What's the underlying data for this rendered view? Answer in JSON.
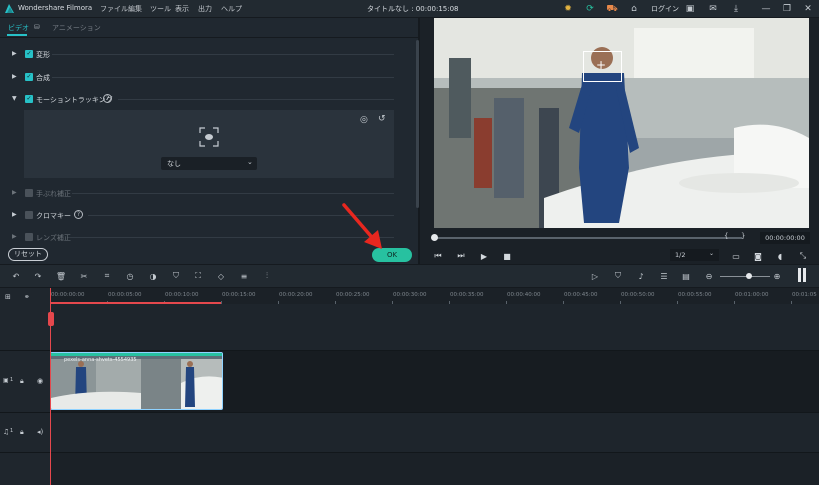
{
  "app": {
    "name": "Wondershare Filmora",
    "menus": [
      "ファイル",
      "編集",
      "ツール",
      "表示",
      "出力",
      "ヘルプ"
    ],
    "document_title": "タイトルなし : 00:00:15:08",
    "login_label": "ログイン",
    "accent_color": "#27c1c7",
    "ok_color": "#27c1a0",
    "playhead_color": "#e5484d"
  },
  "left_panel": {
    "tabs": [
      "ビデオ",
      "オーディオ",
      "アニメーション"
    ],
    "sections": [
      {
        "label": "変形",
        "checked": true
      },
      {
        "label": "合成",
        "checked": true
      },
      {
        "label": "モーショントラッキング",
        "checked": true
      },
      {
        "label": "手ぶれ補正",
        "checked": false
      },
      {
        "label": "クロマキー",
        "checked": false
      },
      {
        "label": "レンズ補正",
        "checked": false
      }
    ],
    "tracking_select": "なし",
    "reset_label": "リセット",
    "ok_label": "OK"
  },
  "preview": {
    "timecode": "00:00:00:00",
    "ratio": "1/2",
    "bracket_left": "{",
    "bracket_right": "}"
  },
  "timeline": {
    "ruler_labels": [
      "00:00:00:00",
      "00:00:05:00",
      "00:00:10:00",
      "00:00:15:00",
      "00:00:20:00",
      "00:00:25:00",
      "00:00:30:00",
      "00:00:35:00",
      "00:00:40:00",
      "00:00:45:00",
      "00:00:50:00",
      "00:00:55:00",
      "00:01:00:00",
      "00:01:05"
    ],
    "clip_label": "pexels-anna-shvets-4554935",
    "video_track_label": "1",
    "audio_track_label": "1"
  }
}
